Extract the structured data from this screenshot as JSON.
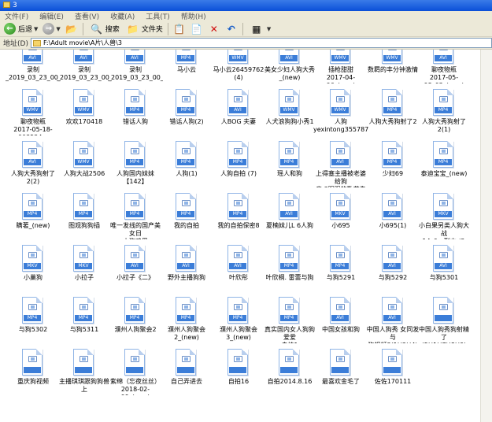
{
  "window": {
    "title": "3"
  },
  "menu": [
    "文件(F)",
    "编辑(E)",
    "查看(V)",
    "收藏(A)",
    "工具(T)",
    "帮助(H)"
  ],
  "toolbar": {
    "back": "后退",
    "search": "搜索",
    "folders": "文件夹"
  },
  "address": {
    "label": "地址(D)",
    "path": "F:\\Adult movie\\A片\\人兽\\3"
  },
  "rows": [
    [
      "录制\n_2019_03_23_00_05...",
      "录制\n_2019_03_23_00_05...",
      "录制\n_2019_03_23_00_05...",
      "马小云",
      "马小云26459762 (4)",
      "美女少妇人狗大秀\n_(new)",
      "插枪甜甜\n2017-04-06_(new)",
      "数羁的丰分钟激情",
      "聊夜物瓶\n2017-05-08_02_(new)"
    ],
    [
      "聊夜物瓶\n2017-05-18-003524...",
      "欢欢170418",
      "错话人狗",
      "错话人狗(2)",
      "人BOG 夫妻",
      "人犬浪狗狗小秀1",
      "人狗\nyexintong355787...",
      "人狗大秀狗射了2",
      "人狗大秀狗射了2(1)"
    ],
    [
      "人狗大秀狗射了2(2)",
      "人狗大战2506",
      "人狗国内妹妹【142】",
      "人狗(1)",
      "人狗自拍 (7)",
      "瑶人和狗",
      "上得塞主播被老婆给狗\n音 3眼眼的数艾先靠",
      "少妇69",
      "泰迪宝宝_(new)"
    ],
    [
      "瞒著_(new)",
      "图观狗狗插",
      "唯一发线的国产美女日\n小狗鸡巴",
      "我的自拍",
      "我的自拍保密8",
      "夏楠妹儿L 6人狗",
      "小695",
      "小695(1)",
      "小白果另类人狗大战\n~14_0 - 副本 (2..."
    ],
    [
      "小巢狗",
      "小拉子",
      "小拉子《二》",
      "野外主播狗狗",
      "叶欣彤",
      "叶欣桐. 雷蕾与狗",
      "与狗5291",
      "与狗5292",
      "与狗5301"
    ],
    [
      "与狗5302",
      "与狗5311",
      "濮州人狗聚会2",
      "濮州人狗聚会2_(new)",
      "濮州人狗聚会3_(new)",
      "真实国内女人狗狗爱爱\n自拍1",
      "中国女孩和狗",
      "中国人狗秀 女同发与\n狗视频3(1)(2)(4)(...",
      "中国人狗秀狗射精了\n(5)(1)(7)(8)(9)(1..."
    ],
    [
      "重庆狗视频",
      "主播琪琪跟狗狗兽上",
      "紫绵（忘夜丝丝）\n2018-02-09_(new)",
      "自己弄进去",
      "自拍16",
      "自拍2014.8.16",
      "最喜欢金毛了",
      "佐佐170111"
    ]
  ],
  "tags": [
    [
      "AVI",
      "AVI",
      "AVI",
      "MP4",
      "WMV",
      "AVI",
      "WMV",
      "WMV",
      "AVI"
    ],
    [
      "WMV",
      "WMV",
      "MP4",
      "MP4",
      "AVI",
      "WMV",
      "WMV",
      "MP4",
      "MP4"
    ],
    [
      "AVI",
      "WMV",
      "MP4",
      "MP4",
      "MP4",
      "MP4",
      "AVI",
      "MP4",
      "MP4"
    ],
    [
      "MP4",
      "MP4",
      "MP4",
      "MP4",
      "MP4",
      "AVI",
      "MKV",
      "AVI",
      "MKV"
    ],
    [
      "MKV",
      "MKV",
      "AVI",
      "AVI",
      "AVI",
      "MP4",
      "MP4",
      "AVI",
      "AVI"
    ],
    [
      "MP4",
      "MP4",
      "MP4",
      "MP4",
      "MP4",
      "MP4",
      "AVI",
      "AVI"
    ]
  ]
}
